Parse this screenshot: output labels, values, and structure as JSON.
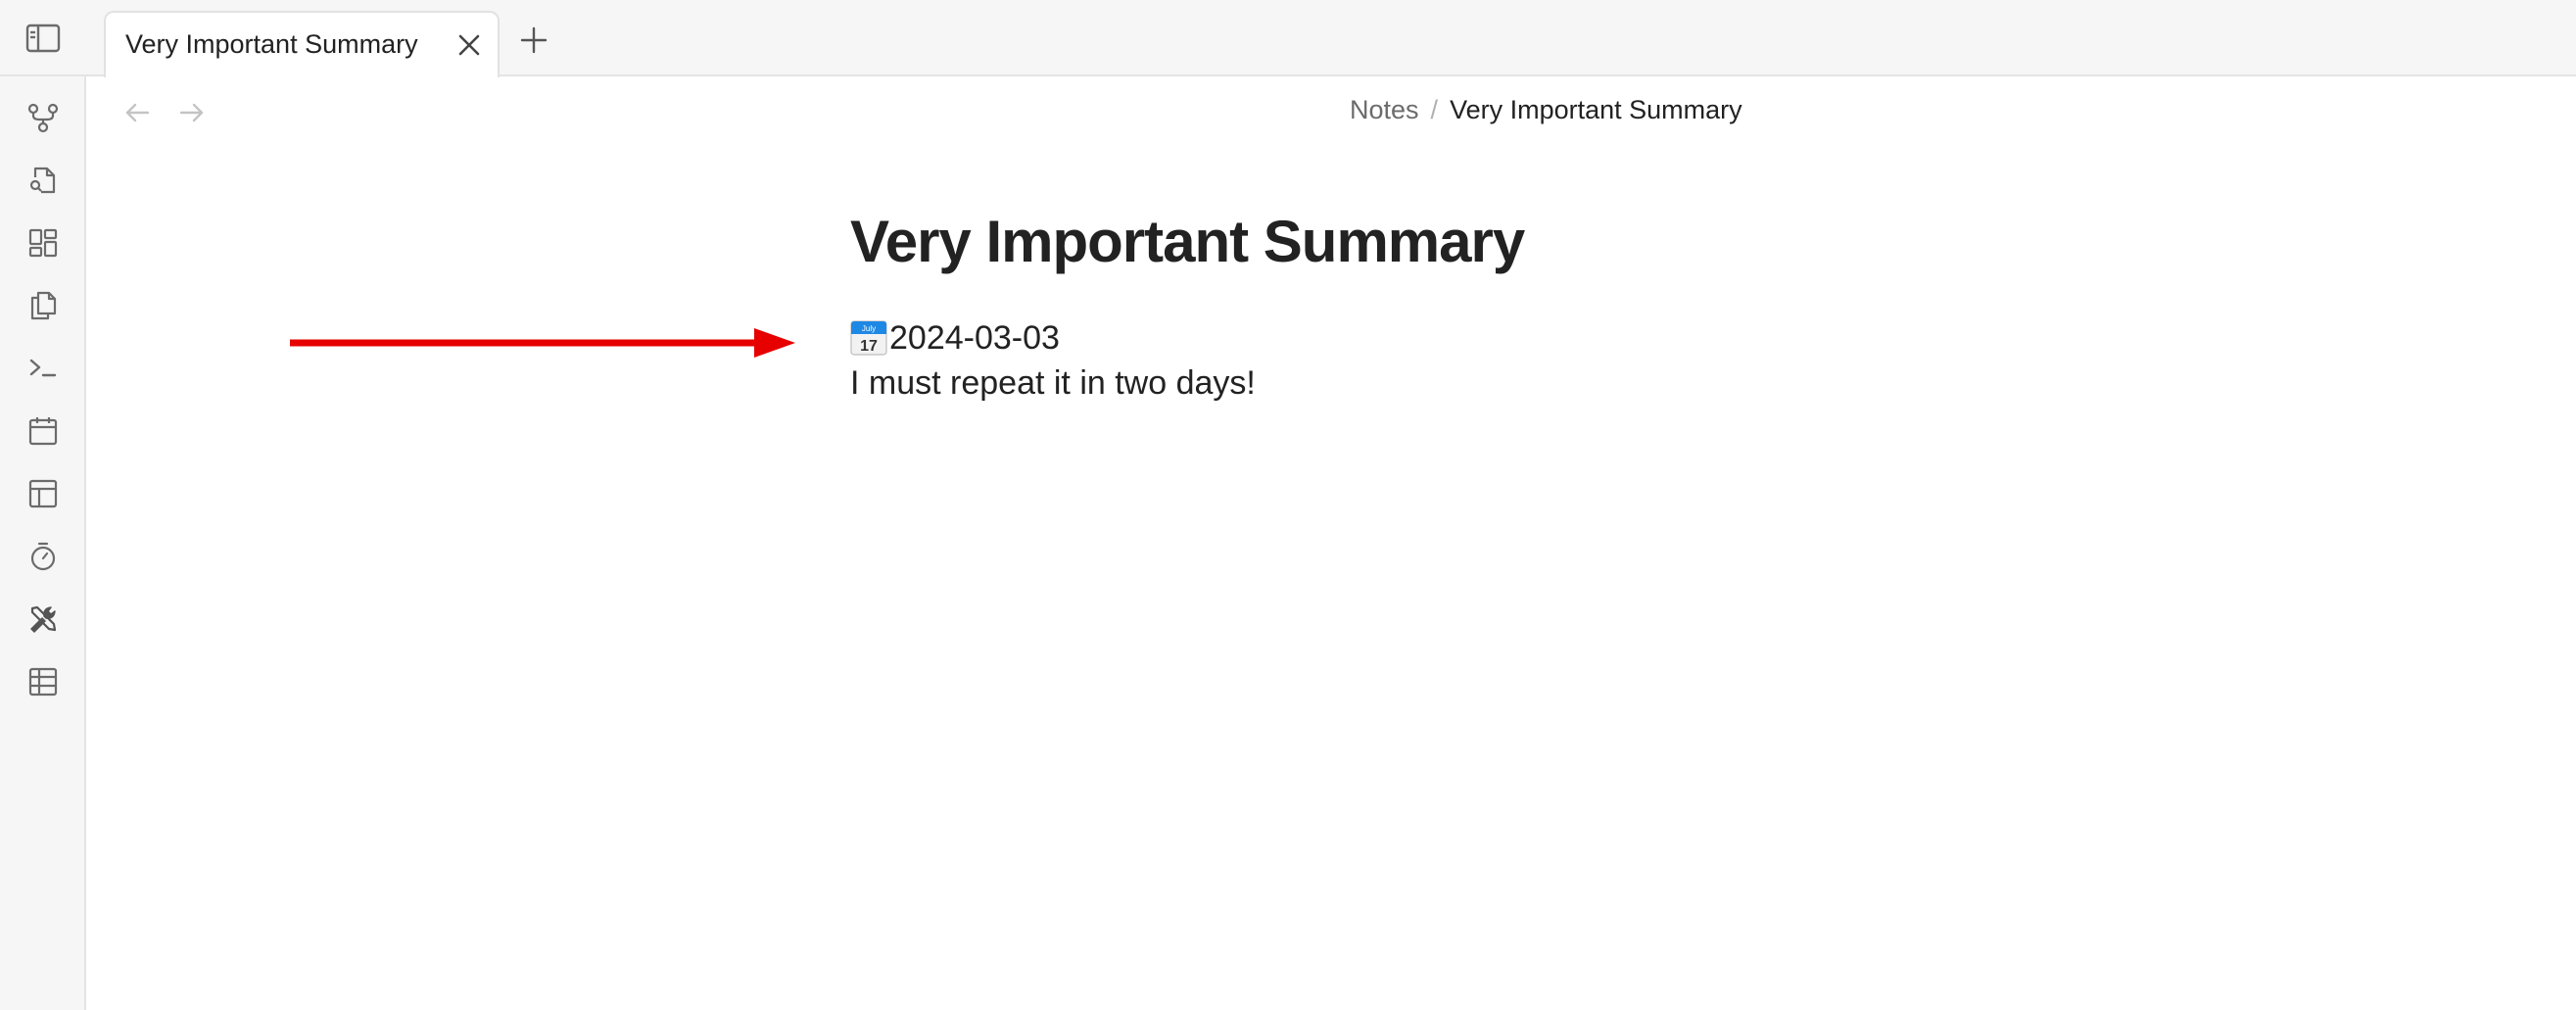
{
  "tabs": [
    {
      "title": "Very Important Summary",
      "active": true
    }
  ],
  "breadcrumb": {
    "parent": "Notes",
    "separator": "/",
    "current": "Very Important Summary"
  },
  "note": {
    "title": "Very Important Summary",
    "date": "2024-03-03",
    "body": "I must repeat it in two days!"
  },
  "calendar_emoji": {
    "month": "July",
    "day": "17"
  },
  "ribbon": {
    "icons": [
      "graph-view-icon",
      "file-search-icon",
      "canvas-icon",
      "copy-files-icon",
      "terminal-icon",
      "calendar-icon",
      "layout-template-icon",
      "timer-icon",
      "tools-icon",
      "table-icon"
    ]
  },
  "annotation": {
    "arrow_color": "#e60000"
  },
  "colors": {
    "chrome_background": "#f6f6f6",
    "border": "#e4e4e4",
    "icon": "#6b6b6b",
    "text": "#222222"
  }
}
